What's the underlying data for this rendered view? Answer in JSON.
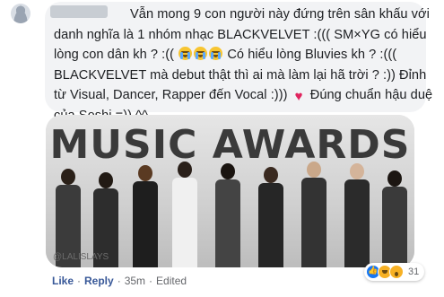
{
  "comment": {
    "lines": [
      "Vẫn mong 9 con người này đứng trên sân khấu với",
      "danh nghĩa là 1 nhóm nhạc BLACKVELVET :((( SM×YG có hiểu",
      "lòng con dân kh ? :((",
      "Có hiểu lòng Bluvies kh ? :(((",
      "BLACKVELVET mà debut thật thì ai mà làm lại hã trời ? :)) Đỉnh",
      "từ Visual, Dancer, Rapper đến Vocal :)))",
      "Đúng chuẩn hậu duệ",
      "của Soshi =)) ^^"
    ]
  },
  "photo": {
    "title": "MUSIC AWARDS",
    "watermark": "@LALISLAYS"
  },
  "actions": {
    "like": "Like",
    "reply": "Reply",
    "separator": "·",
    "time": "35m",
    "edited": "Edited"
  },
  "reactions": {
    "count": "31",
    "icons": [
      "like-icon",
      "haha-icon",
      "wow-icon"
    ]
  },
  "colors": {
    "bubble": "#f2f3f5",
    "link": "#385898",
    "meta": "#65676b",
    "heart": "#e0245e",
    "like_blue": "#1877f2"
  }
}
